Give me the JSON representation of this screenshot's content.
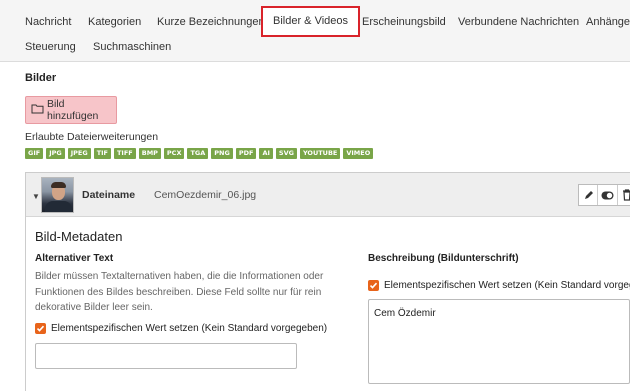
{
  "tabs": [
    {
      "label": "Nachricht",
      "active": false
    },
    {
      "label": "Kategorien",
      "active": false
    },
    {
      "label": "Kurze Bezeichnungen",
      "active": false
    },
    {
      "label": "Bilder & Videos",
      "active": true
    },
    {
      "label": "Erscheinungsbild",
      "active": false
    },
    {
      "label": "Verbundene Nachrichten",
      "active": false
    },
    {
      "label": "Anhänge",
      "active": false
    },
    {
      "label": "Steuerung",
      "active": false
    },
    {
      "label": "Suchmaschinen",
      "active": false
    }
  ],
  "images_section": {
    "title": "Bilder",
    "add_button": "Bild hinzufügen",
    "extensions_label": "Erlaubte Dateierweiterungen",
    "extensions": [
      "GIF",
      "JPG",
      "JPEG",
      "TIF",
      "TIFF",
      "BMP",
      "PCX",
      "TGA",
      "PNG",
      "PDF",
      "AI",
      "SVG",
      "YOUTUBE",
      "VIMEO"
    ],
    "extension_color": "#79a548"
  },
  "file": {
    "name_label": "Dateiname",
    "name_value": "CemOezdemir_06.jpg",
    "actions": [
      "pencil-icon",
      "toggle-icon",
      "trash-icon"
    ]
  },
  "metadata": {
    "title": "Bild-Metadaten",
    "alt": {
      "title": "Alternativer Text",
      "help": "Bilder müssen Textalternativen haben, die die Informationen oder Funktionen des Bildes beschreiben. Diese Feld sollte nur für rein dekorative Bilder leer sein.",
      "checkbox_label": "Elementspezifischen Wert setzen (Kein Standard vorgegeben)",
      "checked": true,
      "value": ""
    },
    "description": {
      "title": "Beschreibung (Bildunterschrift)",
      "checkbox_label": "Elementspezifischen Wert setzen (Kein Standard vorgegeben)",
      "checked": true,
      "value": "Cem Özdemir"
    }
  },
  "colors": {
    "accent": "#e8641b",
    "active_tab_border": "#d9232a",
    "add_button_bg": "#f7c5c9"
  }
}
